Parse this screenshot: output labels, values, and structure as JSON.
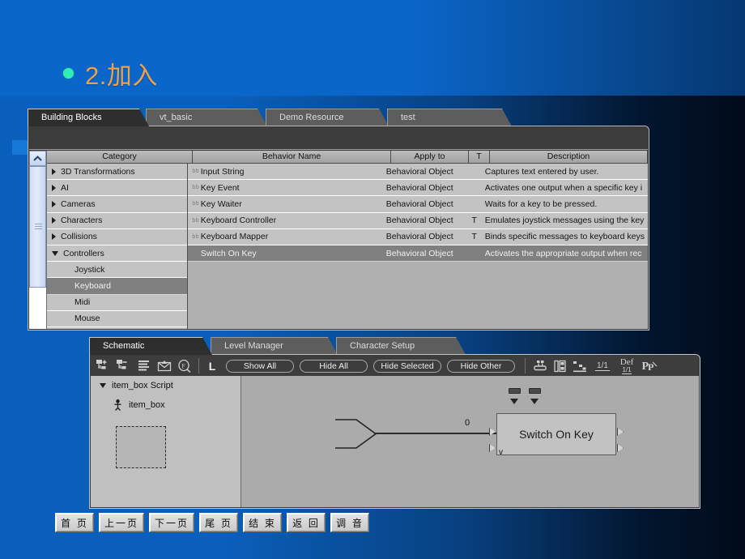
{
  "slide": {
    "title": "2.加入",
    "bullet_color": "#2ff0b4",
    "title_color": "#f0a04a",
    "background_color": "#0b66c9"
  },
  "building_blocks_panel": {
    "tabs": [
      {
        "label": "Building Blocks",
        "active": true
      },
      {
        "label": "vt_basic",
        "active": false
      },
      {
        "label": "Demo Resource",
        "active": false
      },
      {
        "label": "test",
        "active": false
      }
    ],
    "scrollbar": {
      "up_arrow": "▲"
    },
    "columns": [
      "Category",
      "Behavior Name",
      "Apply to",
      "T",
      "Description"
    ],
    "categories": [
      {
        "label": "3D Transformations",
        "state": "collapsed",
        "level": 0,
        "selected": false
      },
      {
        "label": "AI",
        "state": "collapsed",
        "level": 0,
        "selected": false
      },
      {
        "label": "Cameras",
        "state": "collapsed",
        "level": 0,
        "selected": false
      },
      {
        "label": "Characters",
        "state": "collapsed",
        "level": 0,
        "selected": false
      },
      {
        "label": "Collisions",
        "state": "collapsed",
        "level": 0,
        "selected": false
      },
      {
        "label": "Controllers",
        "state": "expanded",
        "level": 0,
        "selected": false
      },
      {
        "label": "Joystick",
        "state": "leaf",
        "level": 1,
        "selected": false
      },
      {
        "label": "Keyboard",
        "state": "leaf",
        "level": 1,
        "selected": true
      },
      {
        "label": "Midi",
        "state": "leaf",
        "level": 1,
        "selected": false
      },
      {
        "label": "Mouse",
        "state": "leaf",
        "level": 1,
        "selected": false
      }
    ],
    "behaviors": [
      {
        "icon": "bb",
        "name": "Input String",
        "apply_to": "Behavioral Object",
        "t": "",
        "description": "Captures text entered by user.",
        "selected": false
      },
      {
        "icon": "bb",
        "name": "Key Event",
        "apply_to": "Behavioral Object",
        "t": "",
        "description": "Activates one output when a specific key i",
        "selected": false
      },
      {
        "icon": "bb",
        "name": "Key Waiter",
        "apply_to": "Behavioral Object",
        "t": "",
        "description": "Waits for a key to be pressed.",
        "selected": false
      },
      {
        "icon": "bb",
        "name": "Keyboard Controller",
        "apply_to": "Behavioral Object",
        "t": "T",
        "description": "Emulates joystick messages using the key",
        "selected": false
      },
      {
        "icon": "bb",
        "name": "Keyboard Mapper",
        "apply_to": "Behavioral Object",
        "t": "T",
        "description": "Binds specific messages to keyboard keys",
        "selected": false
      },
      {
        "icon": "bb",
        "name": "Switch On Key",
        "apply_to": "Behavioral Object",
        "t": "",
        "description": "Activates the appropriate output when rec",
        "selected": true
      }
    ]
  },
  "schematic_panel": {
    "tabs": [
      {
        "label": "Schematic",
        "active": true
      },
      {
        "label": "Level Manager",
        "active": false
      },
      {
        "label": "Character Setup",
        "active": false
      }
    ],
    "toolbar": {
      "icons": [
        "add-script-icon",
        "remove-script-icon",
        "list-icon",
        "mail-icon",
        "find-f-icon"
      ],
      "letter_button": "L",
      "buttons": [
        "Show All",
        "Hide All",
        "Hide Selected",
        "Hide Other"
      ],
      "right_icons": [
        "group-icon",
        "layout-icon",
        "hierarchy-icon"
      ],
      "zoom_label": "1/1",
      "default_label": "Def",
      "default_sub_label": "1/1",
      "pp_label": "PP"
    },
    "tree": {
      "root": "item_box Script",
      "child": "item_box"
    },
    "canvas": {
      "node_label": "Switch On Key",
      "wire_label": "0",
      "down_arrow_glyph": "▼"
    }
  },
  "footer": {
    "buttons": [
      "首 页",
      "上一页",
      "下一页",
      "尾 页",
      "结 束",
      "返 回",
      "调 音"
    ]
  }
}
